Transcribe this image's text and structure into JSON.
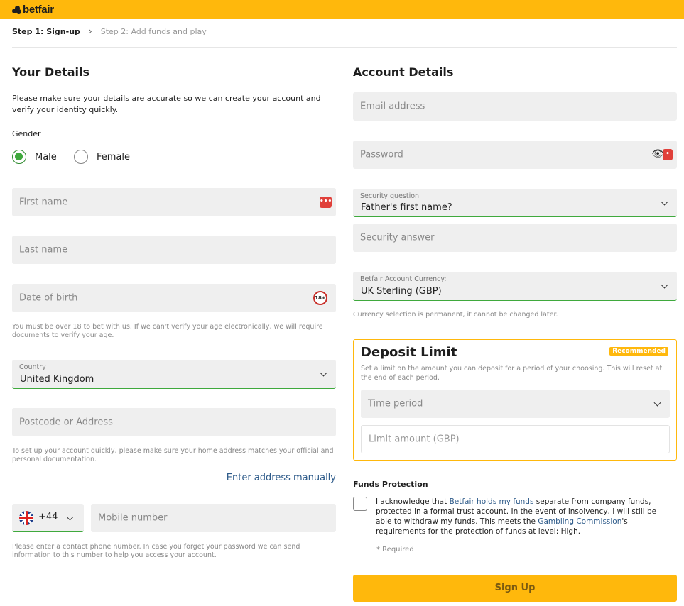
{
  "brand": {
    "name": "betfair",
    "accent": "#ffb80c"
  },
  "steps": {
    "step1": "Step 1: Sign-up",
    "step2": "Step 2: Add funds and play"
  },
  "your_details": {
    "title": "Your Details",
    "intro": "Please make sure your details are accurate so we can create your account and verify your identity quickly.",
    "gender_label": "Gender",
    "gender_options": [
      "Male",
      "Female"
    ],
    "gender_selected": "Male",
    "first_name_placeholder": "First name",
    "last_name_placeholder": "Last name",
    "dob_placeholder": "Date of birth",
    "age_badge": "18+",
    "age_hint": "You must be over 18 to bet with us. If we can't verify your age electronically, we will require documents to verify your age.",
    "country_label": "Country",
    "country_value": "United Kingdom",
    "postcode_placeholder": "Postcode or Address",
    "address_hint": "To set up your account quickly, please make sure your home address matches your official and personal documentation.",
    "enter_address_link": "Enter address manually",
    "phone_code": "+44",
    "mobile_placeholder": "Mobile number",
    "phone_hint": "Please enter a contact phone number. In case you forget your password we can send information to this number to help you access your account."
  },
  "account_details": {
    "title": "Account Details",
    "email_placeholder": "Email address",
    "password_placeholder": "Password",
    "security_question_label": "Security question",
    "security_question_value": "Father's first name?",
    "security_answer_placeholder": "Security answer",
    "currency_label": "Betfair Account Currency:",
    "currency_value": "UK Sterling (GBP)",
    "currency_hint": "Currency selection is permanent, it cannot be changed later."
  },
  "deposit_limit": {
    "title": "Deposit Limit",
    "badge": "Recommended",
    "description": "Set a limit on the amount you can deposit for a period of your choosing. This will reset at the end of each period.",
    "time_period_placeholder": "Time period",
    "limit_amount_placeholder": "Limit amount (GBP)"
  },
  "funds_protection": {
    "title": "Funds Protection",
    "text_1": "I acknowledge that ",
    "link_1": "Betfair holds my funds",
    "text_2": " separate from company funds, protected in a formal trust account. In the event of insolvency, I will still be able to withdraw my funds. This meets the ",
    "link_2": "Gambling Commission",
    "text_3": "'s requirements for the protection of funds at level: High.",
    "required_note": "* Required"
  },
  "signup_button": "Sign Up"
}
